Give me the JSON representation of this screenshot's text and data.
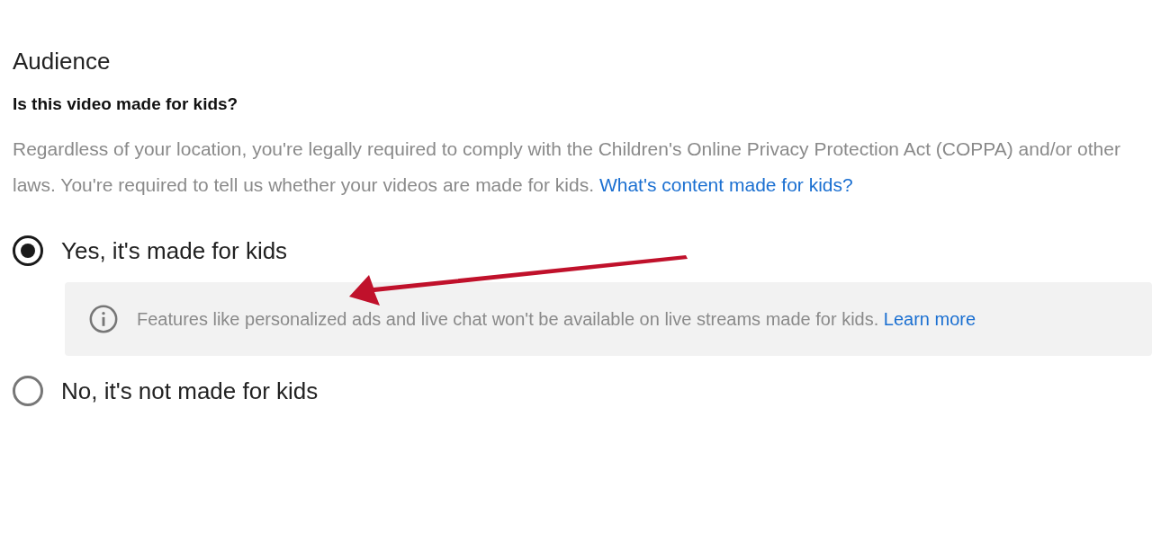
{
  "section": {
    "title": "Audience",
    "question": "Is this video made for kids?",
    "description": "Regardless of your location, you're legally required to comply with the Children's Online Privacy Protection Act (COPPA) and/or other laws. You're required to tell us whether your videos are made for kids.",
    "description_link": "What's content made for kids?"
  },
  "options": [
    {
      "label": "Yes, it's made for kids",
      "selected": true,
      "note": {
        "text": "Features like personalized ads and live chat won't be available on live streams made for kids.",
        "link": "Learn more"
      }
    },
    {
      "label": "No, it's not made for kids",
      "selected": false
    }
  ]
}
